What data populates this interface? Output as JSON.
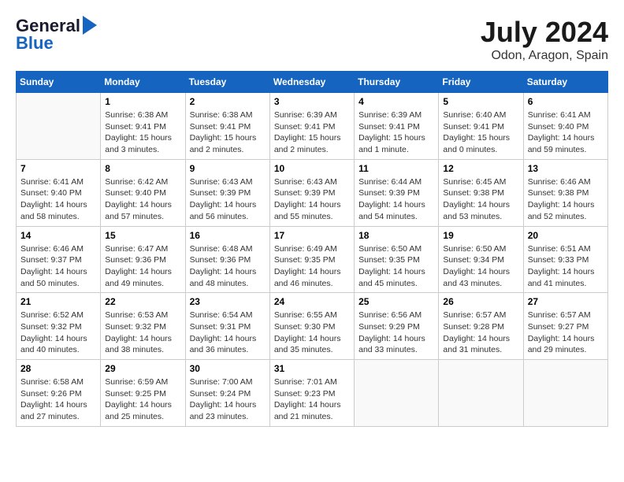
{
  "header": {
    "logo_general": "General",
    "logo_blue": "Blue",
    "month_title": "July 2024",
    "location": "Odon, Aragon, Spain"
  },
  "calendar": {
    "days_of_week": [
      "Sunday",
      "Monday",
      "Tuesday",
      "Wednesday",
      "Thursday",
      "Friday",
      "Saturday"
    ],
    "weeks": [
      [
        {
          "day": "",
          "info": ""
        },
        {
          "day": "1",
          "info": "Sunrise: 6:38 AM\nSunset: 9:41 PM\nDaylight: 15 hours\nand 3 minutes."
        },
        {
          "day": "2",
          "info": "Sunrise: 6:38 AM\nSunset: 9:41 PM\nDaylight: 15 hours\nand 2 minutes."
        },
        {
          "day": "3",
          "info": "Sunrise: 6:39 AM\nSunset: 9:41 PM\nDaylight: 15 hours\nand 2 minutes."
        },
        {
          "day": "4",
          "info": "Sunrise: 6:39 AM\nSunset: 9:41 PM\nDaylight: 15 hours\nand 1 minute."
        },
        {
          "day": "5",
          "info": "Sunrise: 6:40 AM\nSunset: 9:41 PM\nDaylight: 15 hours\nand 0 minutes."
        },
        {
          "day": "6",
          "info": "Sunrise: 6:41 AM\nSunset: 9:40 PM\nDaylight: 14 hours\nand 59 minutes."
        }
      ],
      [
        {
          "day": "7",
          "info": "Sunrise: 6:41 AM\nSunset: 9:40 PM\nDaylight: 14 hours\nand 58 minutes."
        },
        {
          "day": "8",
          "info": "Sunrise: 6:42 AM\nSunset: 9:40 PM\nDaylight: 14 hours\nand 57 minutes."
        },
        {
          "day": "9",
          "info": "Sunrise: 6:43 AM\nSunset: 9:39 PM\nDaylight: 14 hours\nand 56 minutes."
        },
        {
          "day": "10",
          "info": "Sunrise: 6:43 AM\nSunset: 9:39 PM\nDaylight: 14 hours\nand 55 minutes."
        },
        {
          "day": "11",
          "info": "Sunrise: 6:44 AM\nSunset: 9:39 PM\nDaylight: 14 hours\nand 54 minutes."
        },
        {
          "day": "12",
          "info": "Sunrise: 6:45 AM\nSunset: 9:38 PM\nDaylight: 14 hours\nand 53 minutes."
        },
        {
          "day": "13",
          "info": "Sunrise: 6:46 AM\nSunset: 9:38 PM\nDaylight: 14 hours\nand 52 minutes."
        }
      ],
      [
        {
          "day": "14",
          "info": "Sunrise: 6:46 AM\nSunset: 9:37 PM\nDaylight: 14 hours\nand 50 minutes."
        },
        {
          "day": "15",
          "info": "Sunrise: 6:47 AM\nSunset: 9:36 PM\nDaylight: 14 hours\nand 49 minutes."
        },
        {
          "day": "16",
          "info": "Sunrise: 6:48 AM\nSunset: 9:36 PM\nDaylight: 14 hours\nand 48 minutes."
        },
        {
          "day": "17",
          "info": "Sunrise: 6:49 AM\nSunset: 9:35 PM\nDaylight: 14 hours\nand 46 minutes."
        },
        {
          "day": "18",
          "info": "Sunrise: 6:50 AM\nSunset: 9:35 PM\nDaylight: 14 hours\nand 45 minutes."
        },
        {
          "day": "19",
          "info": "Sunrise: 6:50 AM\nSunset: 9:34 PM\nDaylight: 14 hours\nand 43 minutes."
        },
        {
          "day": "20",
          "info": "Sunrise: 6:51 AM\nSunset: 9:33 PM\nDaylight: 14 hours\nand 41 minutes."
        }
      ],
      [
        {
          "day": "21",
          "info": "Sunrise: 6:52 AM\nSunset: 9:32 PM\nDaylight: 14 hours\nand 40 minutes."
        },
        {
          "day": "22",
          "info": "Sunrise: 6:53 AM\nSunset: 9:32 PM\nDaylight: 14 hours\nand 38 minutes."
        },
        {
          "day": "23",
          "info": "Sunrise: 6:54 AM\nSunset: 9:31 PM\nDaylight: 14 hours\nand 36 minutes."
        },
        {
          "day": "24",
          "info": "Sunrise: 6:55 AM\nSunset: 9:30 PM\nDaylight: 14 hours\nand 35 minutes."
        },
        {
          "day": "25",
          "info": "Sunrise: 6:56 AM\nSunset: 9:29 PM\nDaylight: 14 hours\nand 33 minutes."
        },
        {
          "day": "26",
          "info": "Sunrise: 6:57 AM\nSunset: 9:28 PM\nDaylight: 14 hours\nand 31 minutes."
        },
        {
          "day": "27",
          "info": "Sunrise: 6:57 AM\nSunset: 9:27 PM\nDaylight: 14 hours\nand 29 minutes."
        }
      ],
      [
        {
          "day": "28",
          "info": "Sunrise: 6:58 AM\nSunset: 9:26 PM\nDaylight: 14 hours\nand 27 minutes."
        },
        {
          "day": "29",
          "info": "Sunrise: 6:59 AM\nSunset: 9:25 PM\nDaylight: 14 hours\nand 25 minutes."
        },
        {
          "day": "30",
          "info": "Sunrise: 7:00 AM\nSunset: 9:24 PM\nDaylight: 14 hours\nand 23 minutes."
        },
        {
          "day": "31",
          "info": "Sunrise: 7:01 AM\nSunset: 9:23 PM\nDaylight: 14 hours\nand 21 minutes."
        },
        {
          "day": "",
          "info": ""
        },
        {
          "day": "",
          "info": ""
        },
        {
          "day": "",
          "info": ""
        }
      ]
    ]
  }
}
